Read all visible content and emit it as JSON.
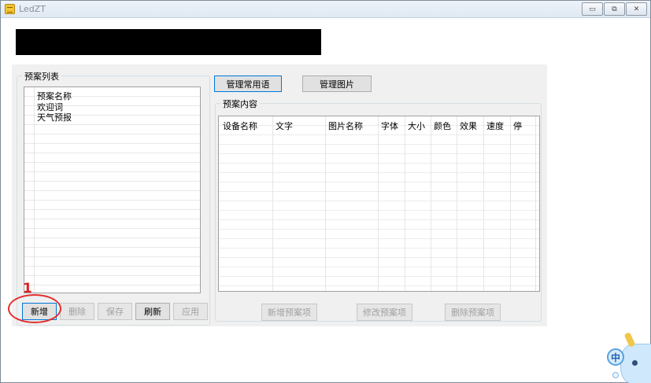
{
  "window": {
    "title": "LedZT",
    "minimize": "▭",
    "restore": "⧉",
    "close": "✕"
  },
  "plan_group": {
    "title": "预案列表",
    "list_header": "预案名称",
    "items": [
      "欢迎词",
      "天气预报"
    ],
    "buttons": {
      "add": "新增",
      "delete": "删除",
      "save": "保存",
      "refresh": "刷新",
      "apply": "应用"
    }
  },
  "top_buttons": {
    "manage_phrases": "管理常用语",
    "manage_images": "管理图片"
  },
  "content_group": {
    "title": "预案内容",
    "columns": [
      "设备名称",
      "文字",
      "图片名称",
      "字体",
      "大小",
      "颜色",
      "效果",
      "速度",
      "停"
    ],
    "buttons": {
      "add_item": "新增预案项",
      "edit_item": "修改预案项",
      "delete_item": "删除预案项"
    }
  },
  "annotation": {
    "number": "1",
    "color": "#e02020"
  },
  "ime": {
    "char": "中"
  }
}
